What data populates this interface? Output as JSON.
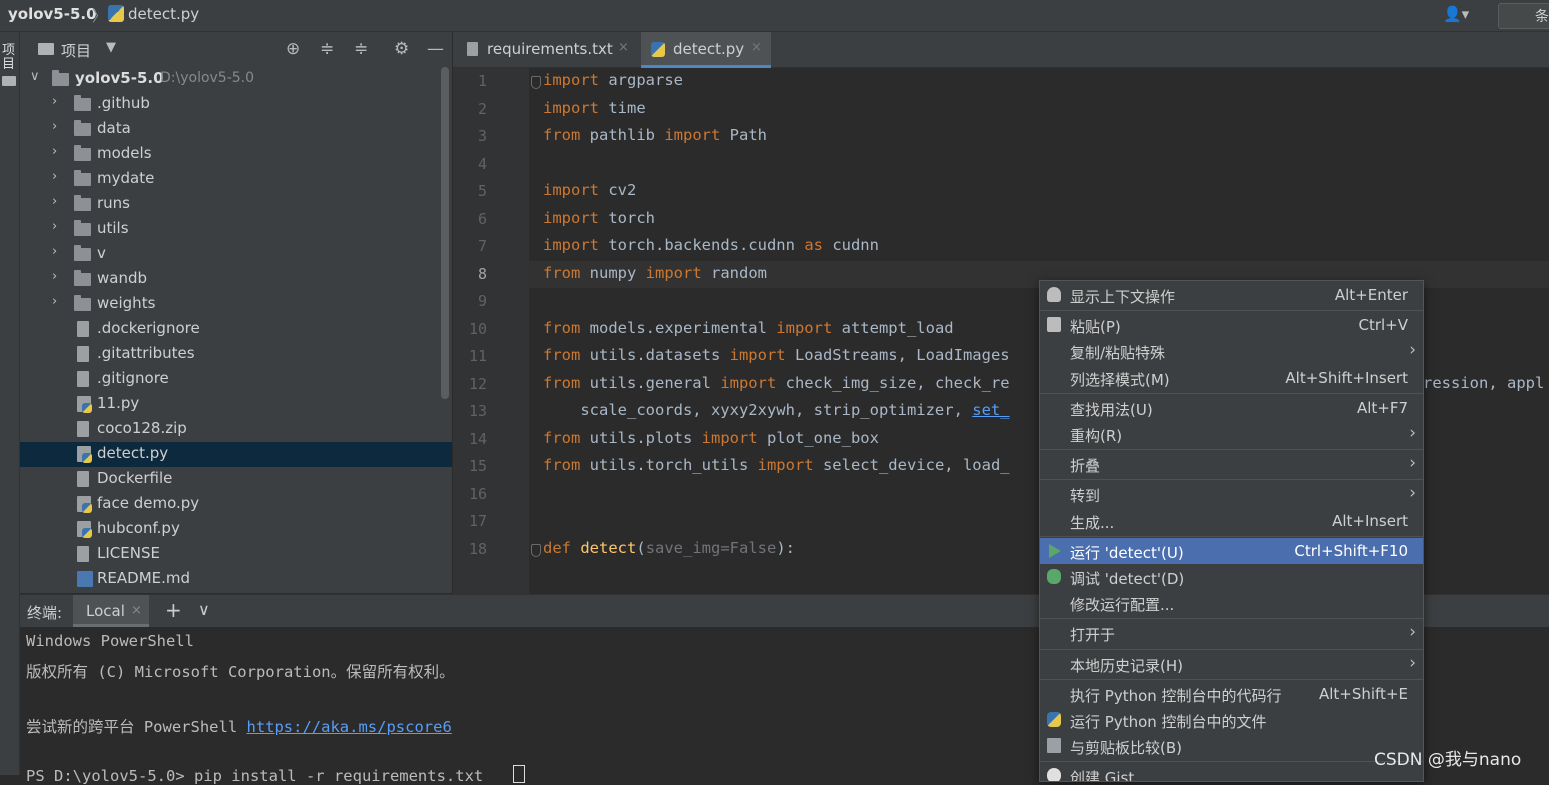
{
  "titlebar": {
    "project": "yolov5-5.0",
    "separator": "〉",
    "file": "detect.py",
    "user_icon": "👤▾",
    "run_config_label": "条"
  },
  "left_strip": {
    "label": "项目"
  },
  "project_panel": {
    "title": "项目",
    "dropdown": "▼",
    "toolbar": [
      "⊕",
      "≑",
      "≑",
      "⚙",
      "—"
    ],
    "tree": [
      {
        "label": "yolov5-5.0",
        "path": "D:\\yolov5-5.0",
        "kind": "root"
      },
      {
        "label": ".github",
        "kind": "folder"
      },
      {
        "label": "data",
        "kind": "folder"
      },
      {
        "label": "models",
        "kind": "folder"
      },
      {
        "label": "mydate",
        "kind": "folder"
      },
      {
        "label": "runs",
        "kind": "folder"
      },
      {
        "label": "utils",
        "kind": "folder"
      },
      {
        "label": "v",
        "kind": "folder"
      },
      {
        "label": "wandb",
        "kind": "folder"
      },
      {
        "label": "weights",
        "kind": "folder"
      },
      {
        "label": ".dockerignore",
        "kind": "file"
      },
      {
        "label": ".gitattributes",
        "kind": "file"
      },
      {
        "label": ".gitignore",
        "kind": "file"
      },
      {
        "label": "11.py",
        "kind": "py"
      },
      {
        "label": "coco128.zip",
        "kind": "file"
      },
      {
        "label": "detect.py",
        "kind": "py",
        "selected": true
      },
      {
        "label": "Dockerfile",
        "kind": "file"
      },
      {
        "label": "face demo.py",
        "kind": "py"
      },
      {
        "label": "hubconf.py",
        "kind": "py"
      },
      {
        "label": "LICENSE",
        "kind": "file"
      },
      {
        "label": "README.md",
        "kind": "md"
      }
    ]
  },
  "editor": {
    "tabs": [
      {
        "label": "requirements.txt",
        "close": "×"
      },
      {
        "label": "detect.py",
        "close": "×",
        "active": true
      }
    ],
    "current_line": 8,
    "line_numbers": [
      "1",
      "2",
      "3",
      "4",
      "5",
      "6",
      "7",
      "8",
      "9",
      "10",
      "11",
      "12",
      "13",
      "14",
      "15",
      "16",
      "17",
      "18"
    ],
    "code": [
      [
        [
          "kw",
          "import"
        ],
        [
          "t",
          " argparse"
        ]
      ],
      [
        [
          "kw",
          "import"
        ],
        [
          "t",
          " time"
        ]
      ],
      [
        [
          "kw",
          "from"
        ],
        [
          "t",
          " pathlib "
        ],
        [
          "kw",
          "import"
        ],
        [
          "t",
          " Path"
        ]
      ],
      [],
      [
        [
          "kw",
          "import"
        ],
        [
          "t",
          " cv2"
        ]
      ],
      [
        [
          "kw",
          "import"
        ],
        [
          "t",
          " torch"
        ]
      ],
      [
        [
          "kw",
          "import"
        ],
        [
          "t",
          " torch.backends.cudnn "
        ],
        [
          "kw",
          "as"
        ],
        [
          "t",
          " cudnn"
        ]
      ],
      [
        [
          "kw",
          "from"
        ],
        [
          "t",
          " numpy "
        ],
        [
          "kw",
          "import"
        ],
        [
          "t",
          " random"
        ]
      ],
      [],
      [
        [
          "kw",
          "from"
        ],
        [
          "t",
          " models.experimental "
        ],
        [
          "kw",
          "import"
        ],
        [
          "t",
          " attempt_load"
        ]
      ],
      [
        [
          "kw",
          "from"
        ],
        [
          "t",
          " utils.datasets "
        ],
        [
          "kw",
          "import"
        ],
        [
          "t",
          " LoadStreams, LoadImages"
        ]
      ],
      [
        [
          "kw",
          "from"
        ],
        [
          "t",
          " utils.general "
        ],
        [
          "kw",
          "import"
        ],
        [
          "t",
          " check_img_size, check_re"
        ]
      ],
      [
        [
          "t",
          "    scale_coords, xyxy2xywh, strip_optimizer, "
        ],
        [
          "ul",
          "set_"
        ]
      ],
      [
        [
          "kw",
          "from"
        ],
        [
          "t",
          " utils.plots "
        ],
        [
          "kw",
          "import"
        ],
        [
          "t",
          " plot_one_box"
        ]
      ],
      [
        [
          "kw",
          "from"
        ],
        [
          "t",
          " utils.torch_utils "
        ],
        [
          "kw",
          "import"
        ],
        [
          "t",
          " select_device, load_"
        ]
      ],
      [],
      [],
      [
        [
          "kw",
          "def"
        ],
        [
          "t",
          " "
        ],
        [
          "fn",
          "detect"
        ],
        [
          "t",
          "("
        ],
        [
          "pm",
          "save_img=False"
        ],
        [
          "t",
          "):"
        ]
      ]
    ],
    "line12_tail": "ression, appl"
  },
  "terminal": {
    "title": "终端:",
    "tab": "Local",
    "tab_close": "×",
    "add": "+",
    "more": "∨",
    "lines": [
      "Windows PowerShell",
      "版权所有 (C) Microsoft Corporation。保留所有权利。",
      "",
      "尝试新的跨平台 PowerShell "
    ],
    "link": "https://aka.ms/pscore6",
    "prompt_line": "PS D:\\yolov5-5.0> pip install -r requirements.txt"
  },
  "context_menu": {
    "items": [
      {
        "label": "显示上下文操作",
        "shortcut": "Alt+Enter",
        "icon": "bulb-icon"
      },
      {
        "sep": true
      },
      {
        "label": "粘贴(P)",
        "shortcut": "Ctrl+V",
        "icon": "clip-icon"
      },
      {
        "label": "复制/粘贴特殊",
        "arrow": "›"
      },
      {
        "label": "列选择模式(M)",
        "shortcut": "Alt+Shift+Insert"
      },
      {
        "sep": true
      },
      {
        "label": "查找用法(U)",
        "shortcut": "Alt+F7"
      },
      {
        "label": "重构(R)",
        "arrow": "›"
      },
      {
        "sep": true
      },
      {
        "label": "折叠",
        "arrow": "›"
      },
      {
        "sep": true
      },
      {
        "label": "转到",
        "arrow": "›"
      },
      {
        "label": "生成...",
        "shortcut": "Alt+Insert"
      },
      {
        "sep": true
      },
      {
        "label": "运行 'detect'(U)",
        "shortcut": "Ctrl+Shift+F10",
        "icon": "run-icon",
        "highlight": true
      },
      {
        "label": "调试 'detect'(D)",
        "icon": "bug-icon"
      },
      {
        "label": "修改运行配置..."
      },
      {
        "sep": true
      },
      {
        "label": "打开于",
        "arrow": "›"
      },
      {
        "sep": true
      },
      {
        "label": "本地历史记录(H)",
        "arrow": "›"
      },
      {
        "sep": true
      },
      {
        "label": "执行 Python 控制台中的代码行",
        "shortcut": "Alt+Shift+E"
      },
      {
        "label": "运行 Python 控制台中的文件",
        "icon": "pyfile-icon"
      },
      {
        "label": "与剪贴板比较(B)",
        "icon": "diff-icon"
      },
      {
        "sep": true
      },
      {
        "label": "创建 Gist...",
        "icon": "gist-icon"
      }
    ]
  },
  "watermark": "CSDN @我与nano",
  "colors": {
    "keyword": "#cc7832",
    "function": "#ffc66d",
    "menu_highlight": "#4b6eaf",
    "selection": "#0d293e"
  }
}
